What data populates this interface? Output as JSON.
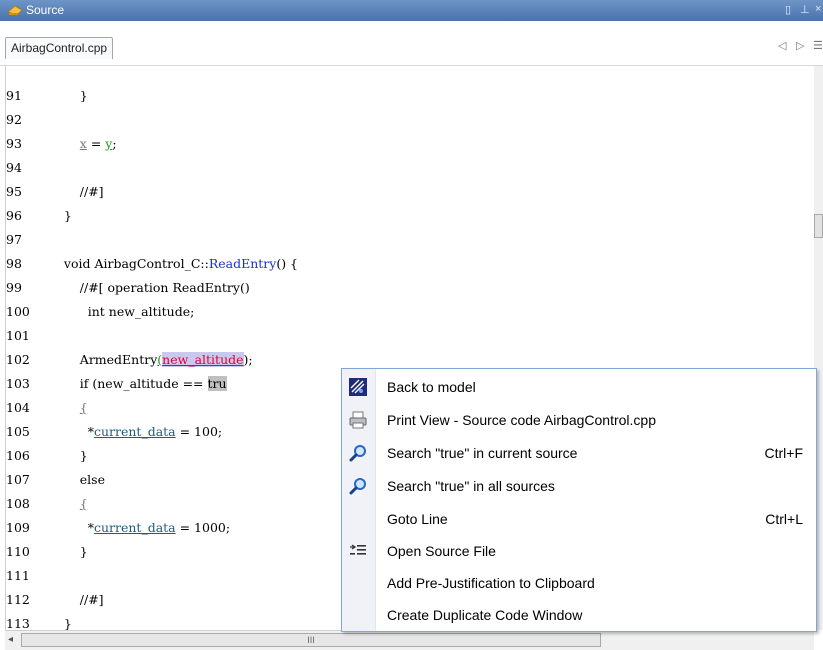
{
  "window": {
    "title": "Source",
    "controls": [
      "▯",
      "⊥",
      "×"
    ]
  },
  "tabs": [
    {
      "label": "AirbagControl.cpp"
    }
  ],
  "tab_nav": {
    "prev": "◁",
    "next": "▷",
    "list": "☰"
  },
  "code": {
    "lines": [
      {
        "num": "91",
        "text": "        }"
      },
      {
        "num": "92",
        "text": ""
      },
      {
        "num": "93",
        "text": ""
      },
      {
        "num": "94",
        "text": ""
      },
      {
        "num": "95",
        "text": "        //#]"
      },
      {
        "num": "96",
        "text": "    }"
      },
      {
        "num": "97",
        "text": ""
      },
      {
        "num": "98",
        "text": ""
      },
      {
        "num": "99",
        "text": "        //#[ operation ReadEntry()"
      },
      {
        "num": "100",
        "text": "          int new_altitude;"
      },
      {
        "num": "101",
        "text": ""
      },
      {
        "num": "102",
        "text": ""
      },
      {
        "num": "103",
        "text": ""
      },
      {
        "num": "104",
        "text": ""
      },
      {
        "num": "105",
        "text": ""
      },
      {
        "num": "106",
        "text": "        }"
      },
      {
        "num": "107",
        "text": "        else"
      },
      {
        "num": "108",
        "text": ""
      },
      {
        "num": "109",
        "text": ""
      },
      {
        "num": "110",
        "text": "        }"
      },
      {
        "num": "111",
        "text": ""
      },
      {
        "num": "112",
        "text": "        //#]"
      },
      {
        "num": "113",
        "text": "    }"
      }
    ],
    "line93": {
      "pre": "        ",
      "x": "x",
      "eq": " = ",
      "y": "y",
      "semi": ";"
    },
    "line98": {
      "pre": "    void AirbagControl_C::",
      "fn": "ReadEntry",
      "post": "() {"
    },
    "line102": {
      "pre": "        ArmedEntry",
      "open": "(",
      "arg": "new_altitude",
      "close": ");"
    },
    "line103": {
      "pre": "        if (new_altitude == ",
      "hl": "tru"
    },
    "line104": {
      "pre": "        ",
      "brace": "{"
    },
    "line105": {
      "pre": "          *",
      "var": "current_data",
      "post": " = 100;"
    },
    "line108": {
      "pre": "        ",
      "brace": "{"
    },
    "line109": {
      "pre": "          *",
      "var": "current_data",
      "post": " = 1000;"
    }
  },
  "scroll": {
    "h_left_arrow": "◂",
    "h_grip": "III"
  },
  "context_menu": {
    "items": [
      {
        "label": "Back to model",
        "icon": "back-to-model-icon",
        "shortcut": ""
      },
      {
        "label": "Print View - Source code AirbagControl.cpp",
        "icon": "printer-icon",
        "shortcut": ""
      },
      {
        "label": "Search \"true\" in current source",
        "icon": "magnifier-icon",
        "shortcut": "Ctrl+F"
      },
      {
        "label": "Search \"true\" in all sources",
        "icon": "magnifier-icon",
        "shortcut": ""
      },
      {
        "label": "Goto Line",
        "icon": "",
        "shortcut": "Ctrl+L"
      },
      {
        "label": "Open Source File",
        "icon": "open-source-file-icon",
        "shortcut": ""
      },
      {
        "label": "Add Pre-Justification to Clipboard",
        "icon": "",
        "shortcut": ""
      },
      {
        "label": "Create Duplicate Code Window",
        "icon": "",
        "shortcut": ""
      }
    ]
  }
}
